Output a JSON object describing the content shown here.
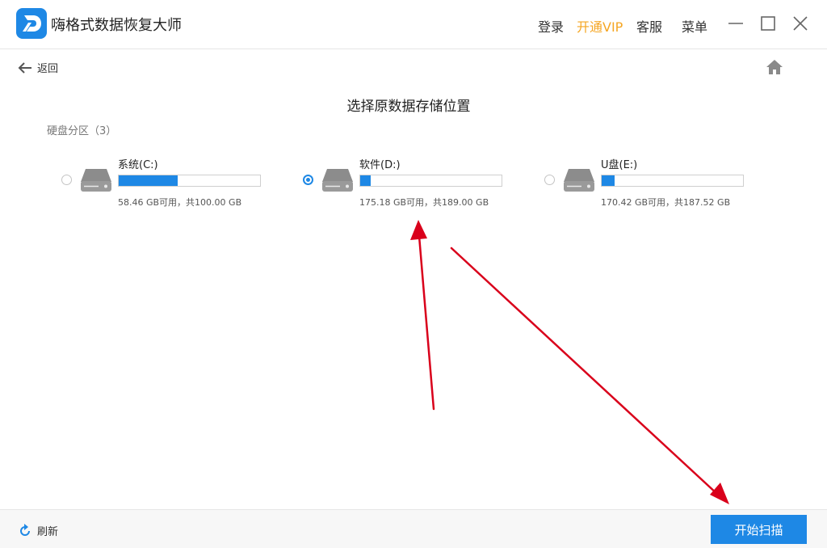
{
  "app": {
    "title": "嗨格式数据恢复大师",
    "logo_icon": "app-logo-icon"
  },
  "titlebar": {
    "login_label": "登录",
    "vip_label": "开通VIP",
    "service_label": "客服",
    "menu_label": "菜单"
  },
  "nav": {
    "back_label": "返回",
    "home_icon": "home-icon"
  },
  "main": {
    "heading": "选择原数据存储位置",
    "section_label": "硬盘分区（3）"
  },
  "drives": [
    {
      "name": "系统(C:)",
      "caption": "58.46 GB可用，共100.00 GB",
      "used_fraction": 0.415,
      "selected": false
    },
    {
      "name": "软件(D:)",
      "caption": "175.18 GB可用，共189.00 GB",
      "used_fraction": 0.073,
      "selected": true
    },
    {
      "name": "U盘(E:)",
      "caption": "170.42 GB可用，共187.52 GB",
      "used_fraction": 0.091,
      "selected": false
    }
  ],
  "footer": {
    "refresh_label": "刷新",
    "start_label": "开始扫描"
  },
  "colors": {
    "accent": "#1e88e5",
    "vip": "#f5a623",
    "annotation": "#d9001b"
  }
}
